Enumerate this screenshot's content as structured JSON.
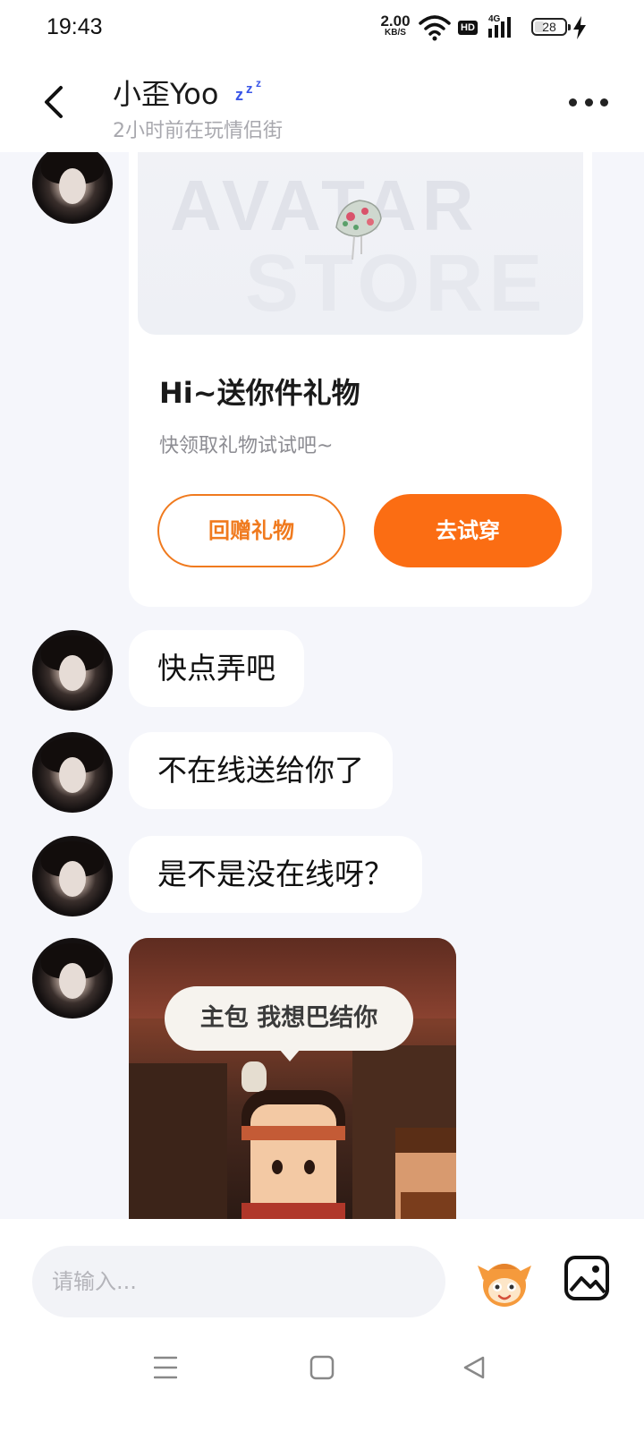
{
  "status_bar": {
    "time": "19:43",
    "net_speed_value": "2.00",
    "net_speed_unit": "KB/S",
    "hd_label": "HD",
    "network_label": "4G",
    "battery_level": "28",
    "icons": [
      "wifi-icon",
      "signal-icon",
      "battery-icon",
      "charging-icon"
    ]
  },
  "header": {
    "back_icon": "chevron-left-icon",
    "title": "小歪Yoo",
    "title_badge_icon": "zzz-sleep-icon",
    "subtitle": "2小时前在玩情侣街",
    "more_icon": "more-dots-icon"
  },
  "gift_card": {
    "banner_watermark_line1": "AVATAR",
    "banner_watermark_line2": "STORE",
    "item_icon": "hat-gift-icon",
    "title": "Hi~送你件礼物",
    "subtitle": "快领取礼物试试吧~",
    "return_gift_button": "回赠礼物",
    "try_on_button": "去试穿"
  },
  "messages": [
    {
      "text": "快点弄吧"
    },
    {
      "text": "不在线送给你了"
    },
    {
      "text": "是不是没在线呀？"
    }
  ],
  "sticker": {
    "speech_text": "主包 我想巴结你"
  },
  "input_bar": {
    "placeholder": "请输入...",
    "emoji_icon": "mascot-emoji-icon",
    "image_icon": "image-icon"
  },
  "nav_bar": {
    "icons": [
      "menu-icon",
      "home-square-icon",
      "back-triangle-icon"
    ]
  },
  "colors": {
    "accent_orange": "#fb6d13",
    "outline_orange": "#f07a1e",
    "background": "#f5f6fb",
    "bubble": "#ffffff"
  }
}
